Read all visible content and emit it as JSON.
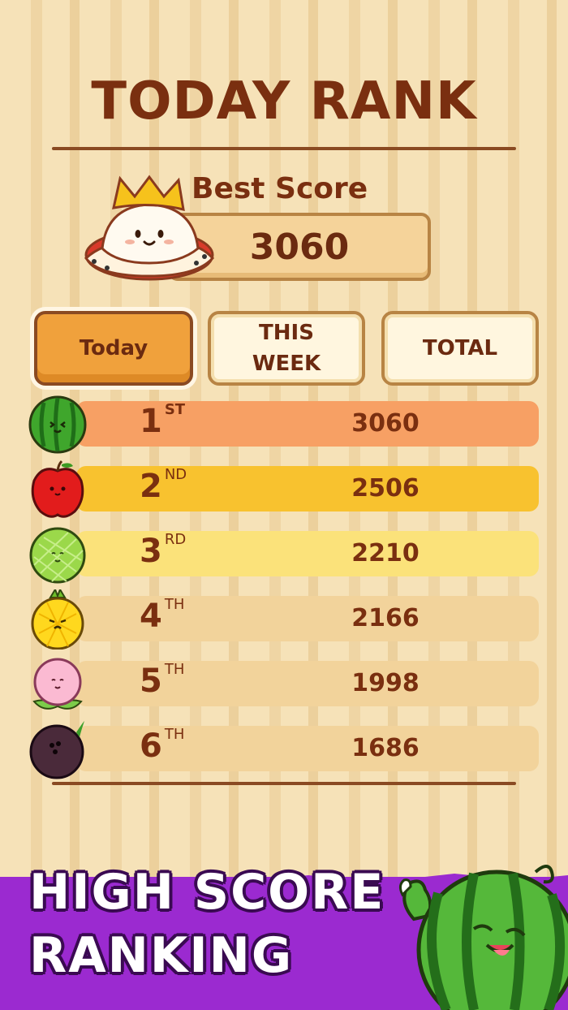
{
  "screen": {
    "title": "TODAY RANK",
    "best_score_label": "Best Score",
    "best_score_value": "3060"
  },
  "tabs": [
    {
      "label": "Today",
      "active": true
    },
    {
      "label_line1": "THIS",
      "label_line2": "WEEK",
      "active": false
    },
    {
      "label": "TOTAL",
      "active": false
    }
  ],
  "rankings": [
    {
      "rank": "1",
      "suffix": "ST",
      "score": "3060",
      "fruit": "watermelon-icon",
      "bar_color": "#f7a064"
    },
    {
      "rank": "2",
      "suffix": "ND",
      "score": "2506",
      "fruit": "apple-icon",
      "bar_color": "#f8c22f"
    },
    {
      "rank": "3",
      "suffix": "RD",
      "score": "2210",
      "fruit": "cantaloupe-icon",
      "bar_color": "#fbe27a"
    },
    {
      "rank": "4",
      "suffix": "TH",
      "score": "2166",
      "fruit": "pineapple-icon",
      "bar_color": "#f2d39b"
    },
    {
      "rank": "5",
      "suffix": "TH",
      "score": "1998",
      "fruit": "peach-icon",
      "bar_color": "#f2d39b"
    },
    {
      "rank": "6",
      "suffix": "TH",
      "score": "1686",
      "fruit": "coconut-icon",
      "bar_color": "#f2d39b"
    }
  ],
  "promo": {
    "line1": "HIGH SCORE",
    "line2": "RANKING"
  },
  "colors": {
    "title_brown": "#7a2f10",
    "accent_orange": "#f0a13c",
    "banner_purple": "#9b2ad0"
  }
}
